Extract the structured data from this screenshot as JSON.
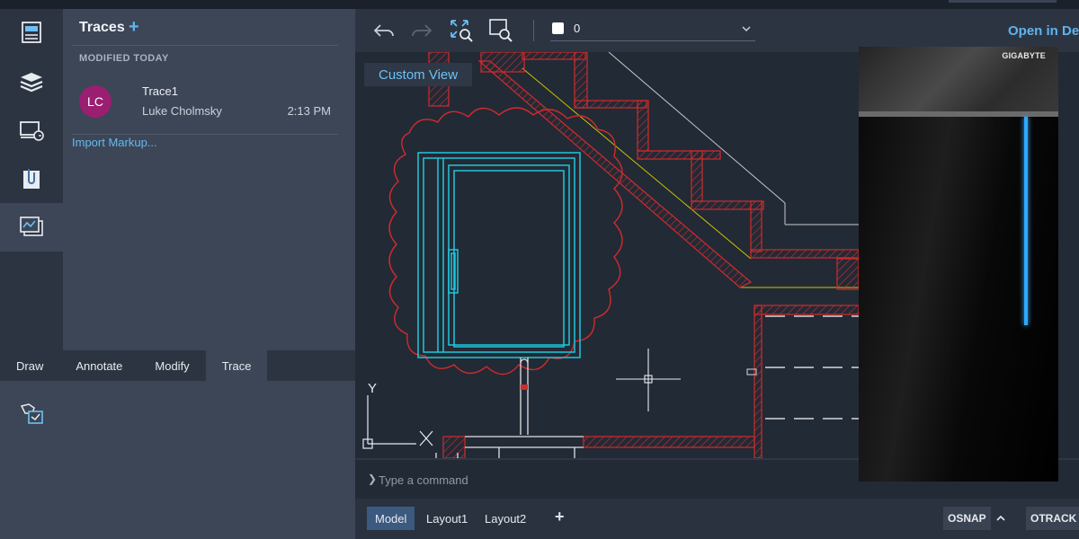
{
  "traces_panel": {
    "title": "Traces",
    "add_icon": "plus-icon",
    "section_label": "MODIFIED TODAY",
    "items": [
      {
        "avatar_initials": "LC",
        "avatar_color": "#9a1f71",
        "name": "Trace1",
        "author": "Luke Cholmsky",
        "time": "2:13 PM"
      }
    ],
    "import_link": "Import Markup..."
  },
  "rail": {
    "icons": [
      "file-properties-icon",
      "layers-icon",
      "blocks-icon",
      "attachments-icon",
      "traces-icon"
    ],
    "active": "traces-icon"
  },
  "tool_tabs": {
    "tabs": [
      "Draw",
      "Annotate",
      "Modify",
      "Trace"
    ],
    "active": "Trace",
    "tool_icon": "trace-tool-icon"
  },
  "toolbar": {
    "icons": [
      "undo-icon",
      "redo-icon",
      "zoom-extents-icon",
      "zoom-window-icon"
    ],
    "layer_color": "#ffffff",
    "layer_name": "0",
    "open_link": "Open in De"
  },
  "canvas": {
    "view_button": "Custom View",
    "ucs_icon": "ucs-axis-icon",
    "ucs_y_label": "Y",
    "crosshair_icon": "crosshair-icon"
  },
  "command": {
    "placeholder": "Type a command"
  },
  "status_bar": {
    "layout_tabs": [
      "Model",
      "Layout1",
      "Layout2"
    ],
    "active_layout": "Model",
    "add_layout_icon": "plus-icon",
    "osnap": "OSNAP",
    "otrack": "OTRACK"
  },
  "product_image": {
    "brand": "GIGABYTE",
    "led_color": "#2ea9ff"
  },
  "colors": {
    "accent": "#5fb4f0",
    "cad_red": "#d12b2b",
    "cad_cyan": "#1ec8d8",
    "cad_yellow": "#c8c400"
  }
}
